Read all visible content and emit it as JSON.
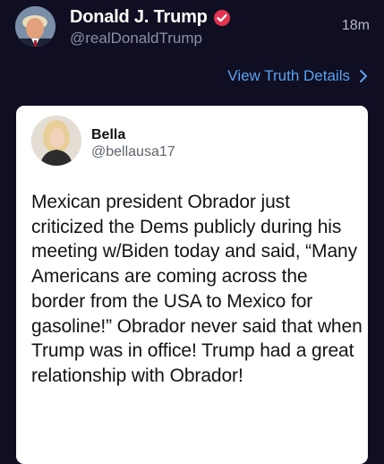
{
  "post": {
    "author_name": "Donald J. Trump",
    "author_handle": "@realDonaldTrump",
    "timestamp": "18m",
    "details_link": "View Truth Details",
    "icons": {
      "avatar": "avatar-photo",
      "verified": "verified-badge-icon",
      "chevron": "chevron-right-icon"
    },
    "colors": {
      "background": "#0f0e22",
      "link": "#5aa2ee",
      "verified": "#e0344f"
    }
  },
  "quoted": {
    "name": "Bella",
    "handle": "@bellausa17",
    "text": "Mexican president Obrador just criticized the Dems publicly during his meeting w/Biden today and said, “Many Americans are coming across the border from the USA to Mexico for gasoline!” Obrador never said that when Trump was in office! Trump had a great relationship with Obrador!"
  }
}
